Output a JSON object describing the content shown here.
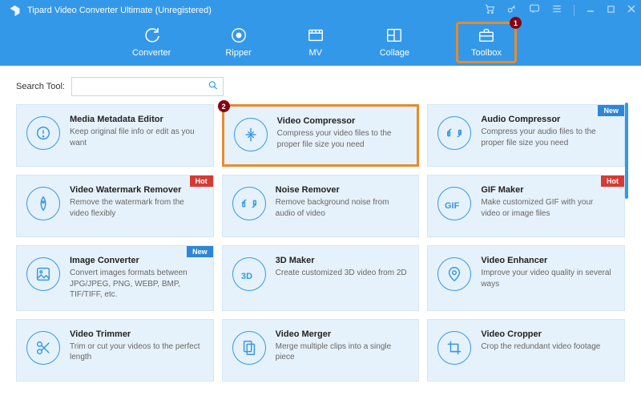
{
  "app": {
    "title": "Tipard Video Converter Ultimate (Unregistered)"
  },
  "nav": {
    "items": [
      {
        "label": "Converter"
      },
      {
        "label": "Ripper"
      },
      {
        "label": "MV"
      },
      {
        "label": "Collage"
      },
      {
        "label": "Toolbox"
      }
    ],
    "active_index": 4
  },
  "search": {
    "label": "Search Tool:",
    "placeholder": ""
  },
  "annotations": {
    "marker1": "1",
    "marker2": "2"
  },
  "cards": [
    {
      "title": "Media Metadata Editor",
      "desc": "Keep original file info or edit as you want",
      "badge": null
    },
    {
      "title": "Video Compressor",
      "desc": "Compress your video files to the proper file size you need",
      "badge": null,
      "highlight": true
    },
    {
      "title": "Audio Compressor",
      "desc": "Compress your audio files to the proper file size you need",
      "badge": "New"
    },
    {
      "title": "Video Watermark Remover",
      "desc": "Remove the watermark from the video flexibly",
      "badge": "Hot"
    },
    {
      "title": "Noise Remover",
      "desc": "Remove background noise from audio of video",
      "badge": null
    },
    {
      "title": "GIF Maker",
      "desc": "Make customized GIF with your video or image files",
      "badge": "Hot"
    },
    {
      "title": "Image Converter",
      "desc": "Convert images formats between JPG/JPEG, PNG, WEBP, BMP, TIF/TIFF, etc.",
      "badge": "New"
    },
    {
      "title": "3D Maker",
      "desc": "Create customized 3D video from 2D",
      "badge": null
    },
    {
      "title": "Video Enhancer",
      "desc": "Improve your video quality in several ways",
      "badge": null
    },
    {
      "title": "Video Trimmer",
      "desc": "Trim or cut your videos to the perfect length",
      "badge": null
    },
    {
      "title": "Video Merger",
      "desc": "Merge multiple clips into a single piece",
      "badge": null
    },
    {
      "title": "Video Cropper",
      "desc": "Crop the redundant video footage",
      "badge": null
    }
  ]
}
